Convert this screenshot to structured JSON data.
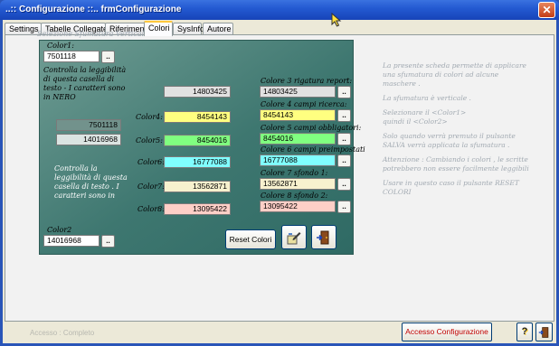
{
  "window": {
    "title": "..:: Configurazione ::..   frmConfigurazione",
    "close_glyph": "✕"
  },
  "tabs": [
    {
      "label": "Settings",
      "active": false
    },
    {
      "label": "Tabelle Collegate",
      "active": false
    },
    {
      "label": "Riferimenti",
      "active": false
    },
    {
      "label": "Colori",
      "active": true
    },
    {
      "label": "SysInfo",
      "active": false
    },
    {
      "label": "Autore",
      "active": false
    }
  ],
  "group": {
    "caption": "Selezione Sfumatura Verticale  Colori"
  },
  "colore1": {
    "label": "Color1:",
    "value": "7501118",
    "hint": "Controlla la leggibilità di questa casella di testo - I caratteri sono in NERO",
    "preview_value": "7501118",
    "preview_value2": "14016968"
  },
  "colore2": {
    "label": "Color2",
    "value": "14016968"
  },
  "white_hint": "Controlla la leggibilità di questa casella di testo . I caratteri sono in",
  "middle": {
    "top_value": "14803425",
    "rows": [
      {
        "label": "Color4:",
        "value": "8454143"
      },
      {
        "label": "Color5:",
        "value": "8454016"
      },
      {
        "label": "Color6:",
        "value": "16777088"
      },
      {
        "label": "Color7:",
        "value": "13562871"
      },
      {
        "label": "Color8:",
        "value": "13095422"
      }
    ]
  },
  "right_fields": [
    {
      "label": "Colore 3 rigatura report:",
      "value": "14803425"
    },
    {
      "label": "Colore 4 campi ricerca:",
      "value": "8454143"
    },
    {
      "label": "Colore 5 campi obbligatori:",
      "value": "8454016"
    },
    {
      "label": "Colore 6 campi preimpostati",
      "value": "16777088"
    },
    {
      "label": "Colore 7 sfondo 1:",
      "value": "13562871"
    },
    {
      "label": "Colore 8 sfondo 2:",
      "value": "13095422"
    }
  ],
  "dots_label": "..",
  "buttons": {
    "reset": "Reset Colori"
  },
  "info": [
    "La presente scheda permette di applicare",
    "una sfumatura di colori ad alcune",
    "maschere .",
    "",
    "La sfumatura è verticale .",
    "",
    "Selezionare il <Color1>",
    "quindi il <Color2>",
    "",
    "Solo quando verrà premuto  il pulsante",
    "SALVA verrà applicata la sfumatura .",
    "",
    "Attenzione : Cambiando i colori , le  scritte",
    "potrebbero non essere facilmente leggibili",
    "",
    "Usare in questo caso il pulsante RESET",
    "COLORI"
  ],
  "status": {
    "access": "Accesso : Completo",
    "config_button": "Accesso Configurazione",
    "help_glyph": "?"
  },
  "colors": {
    "color4": "#ffff80",
    "color5": "#80ff80",
    "color6": "#80ffff",
    "color7": "#f7f1ce",
    "color8": "#fecfc7",
    "color3": "#e1e1e1"
  },
  "icons": [
    "save-pen-icon",
    "exit-door-icon",
    "help-icon",
    "exit-icon",
    "mouse-cursor-icon"
  ]
}
